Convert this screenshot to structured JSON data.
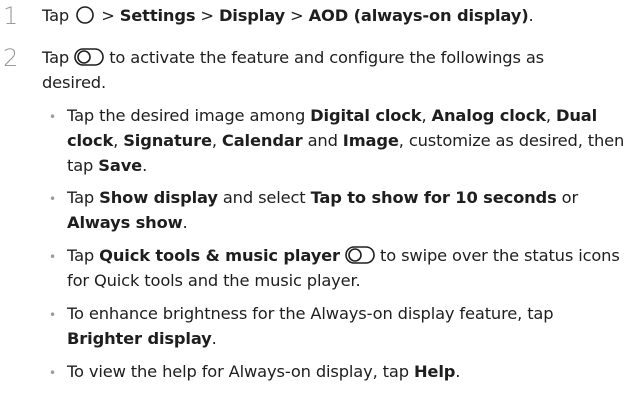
{
  "steps": [
    {
      "number": "1",
      "line1": {
        "a": "Tap",
        "b": ">",
        "c": "Settings",
        "d": ">",
        "e": "Display",
        "f": ">",
        "g": "AOD (always-on display)",
        "h": "."
      }
    },
    {
      "number": "2",
      "line1": {
        "a": "Tap",
        "b": "to activate the feature and configure the followings as"
      },
      "line2": "desired."
    }
  ],
  "bullets": [
    {
      "l1": {
        "a": "Tap the desired image among",
        "b": "Digital clock",
        "c": ",",
        "d": "Analog clock",
        "e": ",",
        "f": "Dual"
      },
      "l2": {
        "a": "clock",
        "b": ",",
        "c": "Signature",
        "d": ",",
        "e": "Calendar",
        "f": "and",
        "g": "Image",
        "h": ", customize as desired, then"
      },
      "l3": {
        "a": "tap",
        "b": "Save",
        "c": "."
      }
    },
    {
      "l1": {
        "a": "Tap",
        "b": "Show display",
        "c": "and select",
        "d": "Tap to show for 10 seconds",
        "e": "or"
      },
      "l2": {
        "a": "Always show",
        "b": "."
      }
    },
    {
      "l1": {
        "a": "Tap",
        "b": "Quick tools & music player",
        "c": "to swipe over the status icons"
      },
      "l2": "for Quick tools and the music player."
    },
    {
      "l1": "To enhance brightness for the Always-on display feature, tap",
      "l2": {
        "a": "Brighter display",
        "b": "."
      }
    },
    {
      "l1": {
        "a": "To view the help for Always-on display, tap",
        "b": "Help",
        "c": "."
      }
    }
  ]
}
